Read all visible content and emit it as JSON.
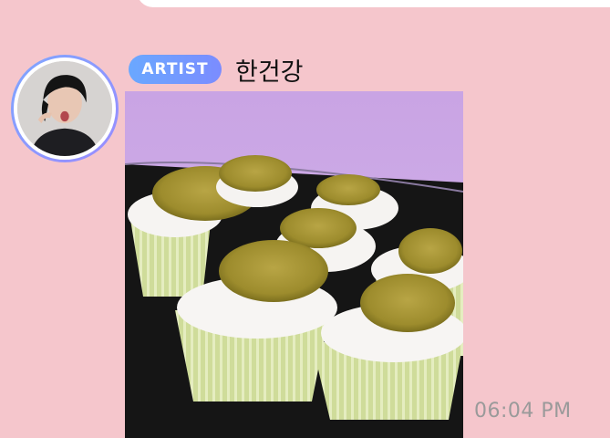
{
  "message": {
    "badge_label": "ARTIST",
    "sender_name": "한건강",
    "timestamp": "06:04 PM"
  },
  "icons": {
    "avatar": "profile-photo",
    "photo": "pickle-cupcakes-photo"
  },
  "colors": {
    "background": "#f5c6cc",
    "badge": "#6aa8ff",
    "timestamp": "#9a9a9a"
  }
}
